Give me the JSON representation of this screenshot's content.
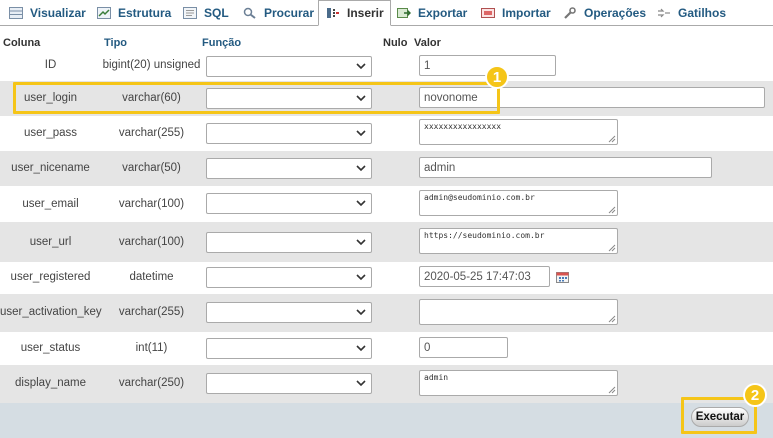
{
  "tabs": [
    {
      "label": "Visualizar",
      "icon": "browse-icon",
      "active": false
    },
    {
      "label": "Estrutura",
      "icon": "structure-icon",
      "active": false
    },
    {
      "label": "SQL",
      "icon": "sql-icon",
      "active": false
    },
    {
      "label": "Procurar",
      "icon": "search-icon",
      "active": false
    },
    {
      "label": "Inserir",
      "icon": "insert-icon",
      "active": true
    },
    {
      "label": "Exportar",
      "icon": "export-icon",
      "active": false
    },
    {
      "label": "Importar",
      "icon": "import-icon",
      "active": false
    },
    {
      "label": "Operações",
      "icon": "wrench-icon",
      "active": false
    },
    {
      "label": "Gatilhos",
      "icon": "triggers-icon",
      "active": false
    }
  ],
  "header": {
    "coluna": "Coluna",
    "tipo": "Tipo",
    "funcao": "Função",
    "nulo": "Nulo",
    "valor": "Valor"
  },
  "rows": [
    {
      "column": "ID",
      "type": "bigint(20) unsigned",
      "value": "1",
      "input": "text"
    },
    {
      "column": "user_login",
      "type": "varchar(60)",
      "value": "novonome",
      "input": "text"
    },
    {
      "column": "user_pass",
      "type": "varchar(255)",
      "value": "xxxxxxxxxxxxxxxx",
      "input": "textarea"
    },
    {
      "column": "user_nicename",
      "type": "varchar(50)",
      "value": "admin",
      "input": "text"
    },
    {
      "column": "user_email",
      "type": "varchar(100)",
      "value": "admin@seudominio.com.br",
      "input": "textarea"
    },
    {
      "column": "user_url",
      "type": "varchar(100)",
      "value": "https://seudominio.com.br",
      "input": "textarea"
    },
    {
      "column": "user_registered",
      "type": "datetime",
      "value": "2020-05-25 17:47:03",
      "input": "datetime"
    },
    {
      "column": "user_activation_key",
      "type": "varchar(255)",
      "value": "",
      "input": "textarea"
    },
    {
      "column": "user_status",
      "type": "int(11)",
      "value": "0",
      "input": "text"
    },
    {
      "column": "display_name",
      "type": "varchar(250)",
      "value": "admin",
      "input": "textarea"
    }
  ],
  "annotations": {
    "step1": "1",
    "step2": "2",
    "color": "#f5c518"
  },
  "submit_label": "Executar",
  "colors": {
    "link": "#235a81",
    "row_alt": "#e5e5e5",
    "footer": "#d5dde3"
  }
}
